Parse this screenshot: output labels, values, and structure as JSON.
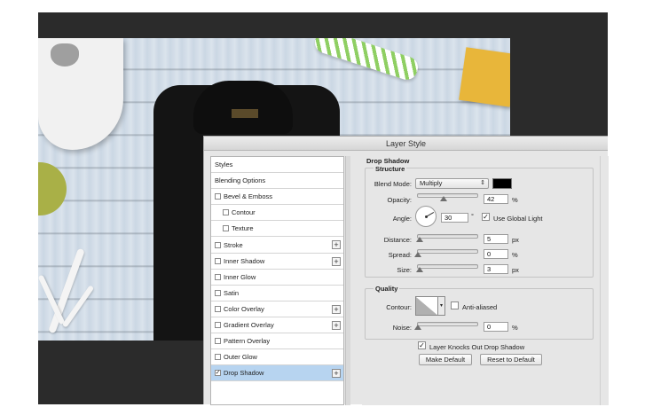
{
  "dialog": {
    "title": "Layer Style"
  },
  "styles": [
    {
      "label": "Styles",
      "has_checkbox": false,
      "checked": false,
      "indent": false,
      "plus": false,
      "selected": false
    },
    {
      "label": "Blending Options",
      "has_checkbox": false,
      "checked": false,
      "indent": false,
      "plus": false,
      "selected": false
    },
    {
      "label": "Bevel & Emboss",
      "has_checkbox": true,
      "checked": false,
      "indent": false,
      "plus": false,
      "selected": false
    },
    {
      "label": "Contour",
      "has_checkbox": true,
      "checked": false,
      "indent": true,
      "plus": false,
      "selected": false
    },
    {
      "label": "Texture",
      "has_checkbox": true,
      "checked": false,
      "indent": true,
      "plus": false,
      "selected": false
    },
    {
      "label": "Stroke",
      "has_checkbox": true,
      "checked": false,
      "indent": false,
      "plus": true,
      "selected": false
    },
    {
      "label": "Inner Shadow",
      "has_checkbox": true,
      "checked": false,
      "indent": false,
      "plus": true,
      "selected": false
    },
    {
      "label": "Inner Glow",
      "has_checkbox": true,
      "checked": false,
      "indent": false,
      "plus": false,
      "selected": false
    },
    {
      "label": "Satin",
      "has_checkbox": true,
      "checked": false,
      "indent": false,
      "plus": false,
      "selected": false
    },
    {
      "label": "Color Overlay",
      "has_checkbox": true,
      "checked": false,
      "indent": false,
      "plus": true,
      "selected": false
    },
    {
      "label": "Gradient Overlay",
      "has_checkbox": true,
      "checked": false,
      "indent": false,
      "plus": true,
      "selected": false
    },
    {
      "label": "Pattern Overlay",
      "has_checkbox": true,
      "checked": false,
      "indent": false,
      "plus": false,
      "selected": false
    },
    {
      "label": "Outer Glow",
      "has_checkbox": true,
      "checked": false,
      "indent": false,
      "plus": false,
      "selected": false
    },
    {
      "label": "Drop Shadow",
      "has_checkbox": true,
      "checked": true,
      "indent": false,
      "plus": true,
      "selected": true
    }
  ],
  "drop_shadow": {
    "title": "Drop Shadow",
    "structure": {
      "title": "Structure",
      "blend_mode_label": "Blend Mode:",
      "blend_mode_value": "Multiply",
      "shadow_color": "#000000",
      "opacity_label": "Opacity:",
      "opacity_value": "42",
      "opacity_unit": "%",
      "angle_label": "Angle:",
      "angle_value": "30",
      "angle_unit": "°",
      "global_light_label": "Use Global Light",
      "global_light_checked": true,
      "distance_label": "Distance:",
      "distance_value": "5",
      "distance_unit": "px",
      "spread_label": "Spread:",
      "spread_value": "0",
      "spread_unit": "%",
      "size_label": "Size:",
      "size_value": "3",
      "size_unit": "px"
    },
    "quality": {
      "title": "Quality",
      "contour_label": "Contour:",
      "anti_aliased_label": "Anti-aliased",
      "anti_aliased_checked": false,
      "noise_label": "Noise:",
      "noise_value": "0",
      "noise_unit": "%"
    },
    "knockout_label": "Layer Knocks Out Drop Shadow",
    "knockout_checked": true,
    "make_default_label": "Make Default",
    "reset_default_label": "Reset to Default"
  }
}
